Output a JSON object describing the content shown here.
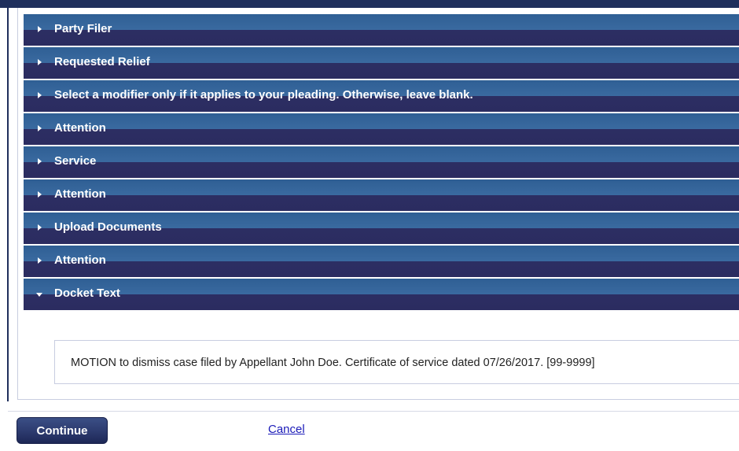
{
  "accordion": {
    "sections": [
      {
        "label": "Party Filer",
        "expanded": false
      },
      {
        "label": "Requested Relief",
        "expanded": false
      },
      {
        "label": "Select a modifier only if it applies to your pleading. Otherwise, leave blank.",
        "expanded": false
      },
      {
        "label": "Attention",
        "expanded": false
      },
      {
        "label": "Service",
        "expanded": false
      },
      {
        "label": "Attention",
        "expanded": false
      },
      {
        "label": "Upload Documents",
        "expanded": false
      },
      {
        "label": "Attention",
        "expanded": false
      },
      {
        "label": "Docket Text",
        "expanded": true
      }
    ]
  },
  "docket": {
    "text": "MOTION to dismiss case filed by Appellant John Doe. Certificate of service dated 07/26/2017. [99-9999]"
  },
  "footer": {
    "continue_label": "Continue",
    "cancel_label": "Cancel"
  },
  "colors": {
    "header_dark": "#2c2e63",
    "header_light": "#3a6aa0",
    "link": "#1a1ab8"
  }
}
